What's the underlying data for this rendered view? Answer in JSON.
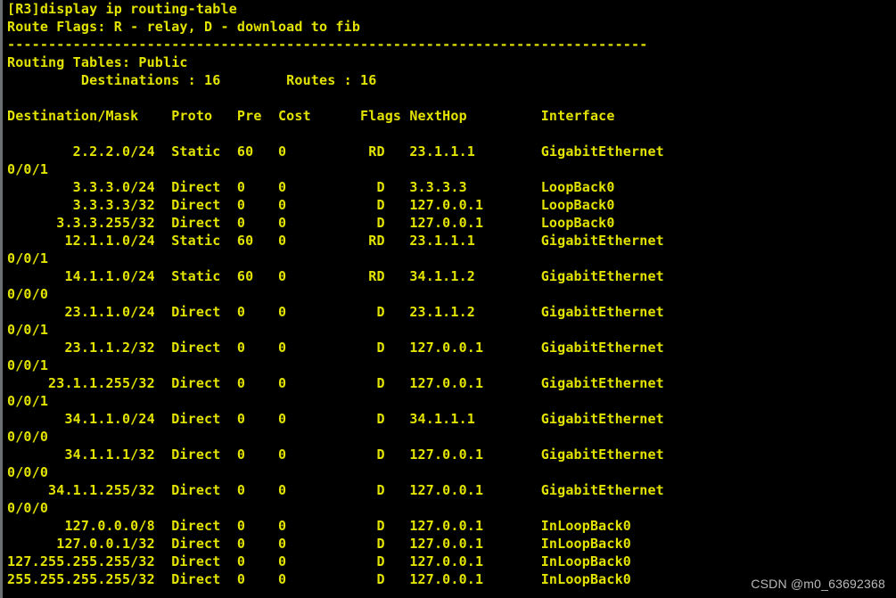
{
  "terminal": {
    "prompt_line": "[R3]display ip routing-table",
    "route_flags_line": "Route Flags: R - relay, D - download to fib",
    "separator": "------------------------------------------------------------------------------",
    "routing_tables_line": "Routing Tables: Public",
    "summary": {
      "destinations_label": "Destinations",
      "destinations_count": "16",
      "routes_label": "Routes",
      "routes_count": "16",
      "line": "         Destinations : 16        Routes : 16"
    },
    "columns": {
      "destination_mask": "Destination/Mask",
      "proto": "Proto",
      "pre": "Pre",
      "cost": "Cost",
      "flags": "Flags",
      "nexthop": "NextHop",
      "interface": "Interface",
      "header_line": "Destination/Mask    Proto   Pre  Cost      Flags NextHop         Interface"
    },
    "routes": [
      {
        "destination_mask": "2.2.2.0/24",
        "proto": "Static",
        "pre": "60",
        "cost": "0",
        "flags": "RD",
        "nexthop": "23.1.1.1",
        "interface": "GigabitEthernet",
        "interface_cont": "0/0/1",
        "line": "        2.2.2.0/24  Static  60   0          RD   23.1.1.1        GigabitEthernet",
        "cont_line": "0/0/1"
      },
      {
        "destination_mask": "3.3.3.0/24",
        "proto": "Direct",
        "pre": "0",
        "cost": "0",
        "flags": "D",
        "nexthop": "3.3.3.3",
        "interface": "LoopBack0",
        "interface_cont": "",
        "line": "        3.3.3.0/24  Direct  0    0           D   3.3.3.3         LoopBack0",
        "cont_line": ""
      },
      {
        "destination_mask": "3.3.3.3/32",
        "proto": "Direct",
        "pre": "0",
        "cost": "0",
        "flags": "D",
        "nexthop": "127.0.0.1",
        "interface": "LoopBack0",
        "interface_cont": "",
        "line": "        3.3.3.3/32  Direct  0    0           D   127.0.0.1       LoopBack0",
        "cont_line": ""
      },
      {
        "destination_mask": "3.3.3.255/32",
        "proto": "Direct",
        "pre": "0",
        "cost": "0",
        "flags": "D",
        "nexthop": "127.0.0.1",
        "interface": "LoopBack0",
        "interface_cont": "",
        "line": "      3.3.3.255/32  Direct  0    0           D   127.0.0.1       LoopBack0",
        "cont_line": ""
      },
      {
        "destination_mask": "12.1.1.0/24",
        "proto": "Static",
        "pre": "60",
        "cost": "0",
        "flags": "RD",
        "nexthop": "23.1.1.1",
        "interface": "GigabitEthernet",
        "interface_cont": "0/0/1",
        "line": "       12.1.1.0/24  Static  60   0          RD   23.1.1.1        GigabitEthernet",
        "cont_line": "0/0/1"
      },
      {
        "destination_mask": "14.1.1.0/24",
        "proto": "Static",
        "pre": "60",
        "cost": "0",
        "flags": "RD",
        "nexthop": "34.1.1.2",
        "interface": "GigabitEthernet",
        "interface_cont": "0/0/0",
        "line": "       14.1.1.0/24  Static  60   0          RD   34.1.1.2        GigabitEthernet",
        "cont_line": "0/0/0"
      },
      {
        "destination_mask": "23.1.1.0/24",
        "proto": "Direct",
        "pre": "0",
        "cost": "0",
        "flags": "D",
        "nexthop": "23.1.1.2",
        "interface": "GigabitEthernet",
        "interface_cont": "0/0/1",
        "line": "       23.1.1.0/24  Direct  0    0           D   23.1.1.2        GigabitEthernet",
        "cont_line": "0/0/1"
      },
      {
        "destination_mask": "23.1.1.2/32",
        "proto": "Direct",
        "pre": "0",
        "cost": "0",
        "flags": "D",
        "nexthop": "127.0.0.1",
        "interface": "GigabitEthernet",
        "interface_cont": "0/0/1",
        "line": "       23.1.1.2/32  Direct  0    0           D   127.0.0.1       GigabitEthernet",
        "cont_line": "0/0/1"
      },
      {
        "destination_mask": "23.1.1.255/32",
        "proto": "Direct",
        "pre": "0",
        "cost": "0",
        "flags": "D",
        "nexthop": "127.0.0.1",
        "interface": "GigabitEthernet",
        "interface_cont": "0/0/1",
        "line": "     23.1.1.255/32  Direct  0    0           D   127.0.0.1       GigabitEthernet",
        "cont_line": "0/0/1"
      },
      {
        "destination_mask": "34.1.1.0/24",
        "proto": "Direct",
        "pre": "0",
        "cost": "0",
        "flags": "D",
        "nexthop": "34.1.1.1",
        "interface": "GigabitEthernet",
        "interface_cont": "0/0/0",
        "line": "       34.1.1.0/24  Direct  0    0           D   34.1.1.1        GigabitEthernet",
        "cont_line": "0/0/0"
      },
      {
        "destination_mask": "34.1.1.1/32",
        "proto": "Direct",
        "pre": "0",
        "cost": "0",
        "flags": "D",
        "nexthop": "127.0.0.1",
        "interface": "GigabitEthernet",
        "interface_cont": "0/0/0",
        "line": "       34.1.1.1/32  Direct  0    0           D   127.0.0.1       GigabitEthernet",
        "cont_line": "0/0/0"
      },
      {
        "destination_mask": "34.1.1.255/32",
        "proto": "Direct",
        "pre": "0",
        "cost": "0",
        "flags": "D",
        "nexthop": "127.0.0.1",
        "interface": "GigabitEthernet",
        "interface_cont": "0/0/0",
        "line": "     34.1.1.255/32  Direct  0    0           D   127.0.0.1       GigabitEthernet",
        "cont_line": "0/0/0"
      },
      {
        "destination_mask": "127.0.0.0/8",
        "proto": "Direct",
        "pre": "0",
        "cost": "0",
        "flags": "D",
        "nexthop": "127.0.0.1",
        "interface": "InLoopBack0",
        "interface_cont": "",
        "line": "       127.0.0.0/8  Direct  0    0           D   127.0.0.1       InLoopBack0",
        "cont_line": ""
      },
      {
        "destination_mask": "127.0.0.1/32",
        "proto": "Direct",
        "pre": "0",
        "cost": "0",
        "flags": "D",
        "nexthop": "127.0.0.1",
        "interface": "InLoopBack0",
        "interface_cont": "",
        "line": "      127.0.0.1/32  Direct  0    0           D   127.0.0.1       InLoopBack0",
        "cont_line": ""
      },
      {
        "destination_mask": "127.255.255.255/32",
        "proto": "Direct",
        "pre": "0",
        "cost": "0",
        "flags": "D",
        "nexthop": "127.0.0.1",
        "interface": "InLoopBack0",
        "interface_cont": "",
        "line": "127.255.255.255/32  Direct  0    0           D   127.0.0.1       InLoopBack0",
        "cont_line": ""
      },
      {
        "destination_mask": "255.255.255.255/32",
        "proto": "Direct",
        "pre": "0",
        "cost": "0",
        "flags": "D",
        "nexthop": "127.0.0.1",
        "interface": "InLoopBack0",
        "interface_cont": "",
        "line": "255.255.255.255/32  Direct  0    0           D   127.0.0.1       InLoopBack0",
        "cont_line": ""
      }
    ],
    "lines": [
      "[R3]display ip routing-table",
      "Route Flags: R - relay, D - download to fib",
      "------------------------------------------------------------------------------",
      "Routing Tables: Public",
      "         Destinations : 16        Routes : 16",
      "",
      "Destination/Mask    Proto   Pre  Cost      Flags NextHop         Interface",
      "",
      "        2.2.2.0/24  Static  60   0          RD   23.1.1.1        GigabitEthernet",
      "0/0/1",
      "        3.3.3.0/24  Direct  0    0           D   3.3.3.3         LoopBack0",
      "        3.3.3.3/32  Direct  0    0           D   127.0.0.1       LoopBack0",
      "      3.3.3.255/32  Direct  0    0           D   127.0.0.1       LoopBack0",
      "       12.1.1.0/24  Static  60   0          RD   23.1.1.1        GigabitEthernet",
      "0/0/1",
      "       14.1.1.0/24  Static  60   0          RD   34.1.1.2        GigabitEthernet",
      "0/0/0",
      "       23.1.1.0/24  Direct  0    0           D   23.1.1.2        GigabitEthernet",
      "0/0/1",
      "       23.1.1.2/32  Direct  0    0           D   127.0.0.1       GigabitEthernet",
      "0/0/1",
      "     23.1.1.255/32  Direct  0    0           D   127.0.0.1       GigabitEthernet",
      "0/0/1",
      "       34.1.1.0/24  Direct  0    0           D   34.1.1.1        GigabitEthernet",
      "0/0/0",
      "       34.1.1.1/32  Direct  0    0           D   127.0.0.1       GigabitEthernet",
      "0/0/0",
      "     34.1.1.255/32  Direct  0    0           D   127.0.0.1       GigabitEthernet",
      "0/0/0",
      "       127.0.0.0/8  Direct  0    0           D   127.0.0.1       InLoopBack0",
      "      127.0.0.1/32  Direct  0    0           D   127.0.0.1       InLoopBack0",
      "127.255.255.255/32  Direct  0    0           D   127.0.0.1       InLoopBack0",
      "255.255.255.255/32  Direct  0    0           D   127.0.0.1       InLoopBack0"
    ]
  },
  "watermark": {
    "text": "CSDN @m0_63692368"
  },
  "colors": {
    "background": "#000000",
    "text": "#e3e300",
    "border": "#6b6f74",
    "watermark": "#b9b9b9"
  }
}
